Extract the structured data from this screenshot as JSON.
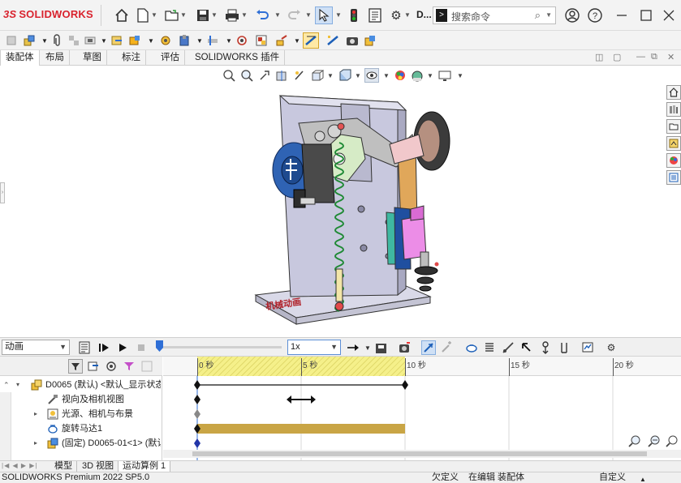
{
  "app": {
    "brand_prefix": "3S",
    "brand": "SOLIDWORKS",
    "doc_short": "D...",
    "search_placeholder": "搜索命令"
  },
  "command_tabs": [
    "装配体",
    "布局",
    "草图",
    "标注",
    "评估",
    "SOLIDWORKS 插件"
  ],
  "motion": {
    "study_type": "动画",
    "speed": "1x",
    "time_labels": [
      "0 秒",
      "5 秒",
      "10 秒",
      "15 秒",
      "20 秒"
    ],
    "tree": [
      {
        "label": "D0065 (默认) <默认_显示状态",
        "expander": "▾",
        "icon": "assembly-icon"
      },
      {
        "label": "视向及相机视图",
        "expander": "",
        "icon": "camera-icon"
      },
      {
        "label": "光源、相机与布景",
        "expander": "▸",
        "icon": "lights-icon"
      },
      {
        "label": "旋转马达1",
        "expander": "",
        "icon": "motor-icon"
      },
      {
        "label": "(固定) D0065-01<1> (默认",
        "expander": "▸",
        "icon": "part-icon"
      }
    ]
  },
  "bottom_tabs": [
    "模型",
    "3D 视图",
    "运动算例 1"
  ],
  "status": {
    "product": "SOLIDWORKS Premium 2022 SP5.0",
    "constraint": "欠定义",
    "mode": "在编辑 装配体",
    "units": "自定义"
  },
  "colors": {
    "brand_red": "#d9232e",
    "timeline_yellow": "#f5f08a",
    "motor_bar": "#c9a545",
    "keyframe": "#1a1a1a",
    "accent_blue": "#2f6fd6"
  },
  "model_label": "机械动画"
}
